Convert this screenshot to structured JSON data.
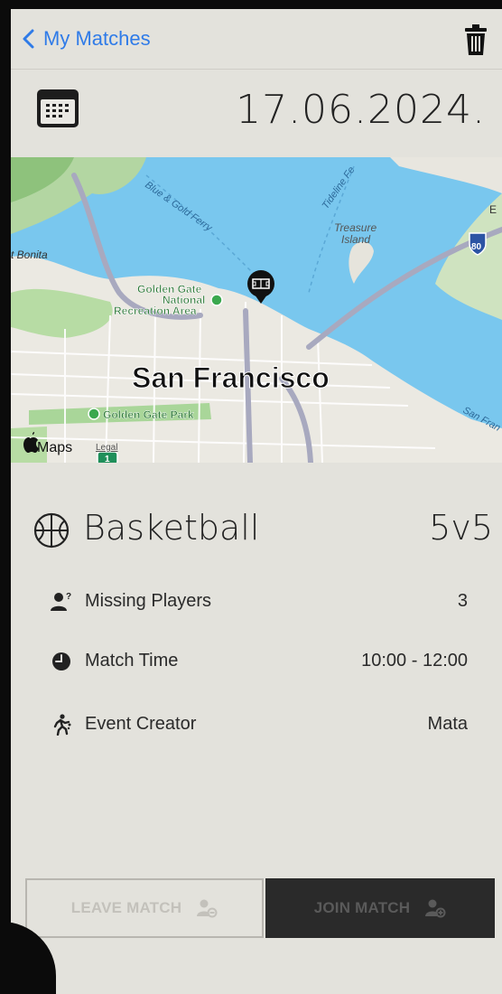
{
  "nav": {
    "back_label": "My Matches"
  },
  "match": {
    "date": "17.06.2024.",
    "sport": "Basketball",
    "format": "5v5"
  },
  "map": {
    "city_label": "San Francisco",
    "places": {
      "park_gg": "Golden Gate Park",
      "gg_national_1": "Golden Gate",
      "gg_national_2": "National",
      "gg_national_3": "Recreation Area",
      "treasure_1": "Treasure",
      "treasure_2": "Island",
      "bonita": "t Bonita",
      "ferry": "Blue & Gold Ferry",
      "tideline": "Tideline Fe",
      "sf_edge": "San Fran",
      "e_edge": "E",
      "shield_80": "80",
      "shield_1": "1"
    },
    "attribution": "Maps",
    "legal": "Legal"
  },
  "details": [
    {
      "icon": "missing-player-icon",
      "label": "Missing Players",
      "value": "3"
    },
    {
      "icon": "clock-icon",
      "label": "Match Time",
      "value": "10:00 - 12:00"
    },
    {
      "icon": "runner-icon",
      "label": "Event Creator",
      "value": "Mata"
    }
  ],
  "actions": {
    "leave_label": "LEAVE MATCH",
    "join_label": "JOIN MATCH"
  },
  "colors": {
    "accent": "#2f7be8",
    "background": "#e3e2dc",
    "join_button": "#2a2a2a"
  }
}
